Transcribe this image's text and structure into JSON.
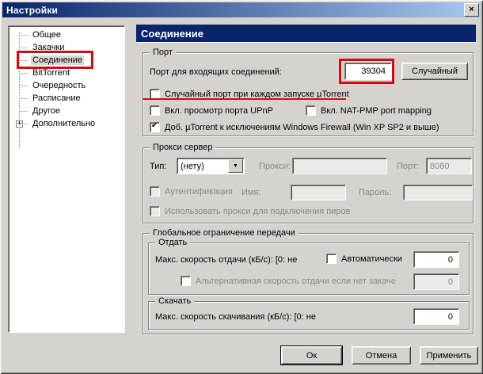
{
  "colors": {
    "titlebar_gradient_start": "#0a246a",
    "titlebar_gradient_end": "#a6caf0",
    "panel_header_bg": "#0a246a",
    "dialog_bg": "#d6d3ce",
    "annotation_red": "#cf0f0f"
  },
  "window": {
    "title": "Настройки",
    "close_glyph": "×"
  },
  "sidebar": {
    "items": [
      {
        "label": "Общее",
        "selected": false
      },
      {
        "label": "Закачки",
        "selected": false
      },
      {
        "label": "Соединение",
        "selected": true
      },
      {
        "label": "BitTorrent",
        "selected": false
      },
      {
        "label": "Очередность",
        "selected": false
      },
      {
        "label": "Расписание",
        "selected": false
      },
      {
        "label": "Другое",
        "selected": false
      },
      {
        "label": "Дополнительно",
        "selected": false,
        "expand_glyph": "+"
      }
    ]
  },
  "header": {
    "title": "Соединение"
  },
  "port": {
    "group_title": "Порт",
    "incoming_label": "Порт для входящих соединений:",
    "port_value": "39304",
    "random_button": "Случайный",
    "cb_random_port": {
      "label": "Случайный порт при каждом запуске µTorrent",
      "checked": false
    },
    "cb_upnp": {
      "label": "Вкл. просмотр порта UPnP",
      "checked": false
    },
    "cb_natpmp": {
      "label": "Вкл. NAT-PMP port mapping",
      "checked": false
    },
    "cb_firewall": {
      "label": "Доб. µTorrent к исключениям Windows Firewall (Win XP SP2 и выше)",
      "checked": true
    }
  },
  "proxy": {
    "group_title": "Прокси сервер",
    "type_label": "Тип:",
    "type_value": "(нету)",
    "proxy_label": "Прокси:",
    "proxy_value": "",
    "port_label": "Порт:",
    "port_value": "8080",
    "cb_auth": {
      "label": "Аутентификация",
      "checked": false
    },
    "name_label": "Имя:",
    "name_value": "",
    "password_label": "Пароль:",
    "password_value": "",
    "cb_peer_proxy": {
      "label": "Использовать прокси для подключения пиров",
      "checked": false
    }
  },
  "limits": {
    "group_title": "Глобальное ограничение передачи",
    "upload": {
      "group_title": "Отдать",
      "max_label": "Макс. скорость отдачи (кБ/с): [0: не",
      "cb_auto": {
        "label": "Автоматически",
        "checked": false
      },
      "value": "0",
      "cb_alt": {
        "label": "Альтернативная скорость отдачи если нет закаче",
        "checked": false
      },
      "alt_value": "0"
    },
    "download": {
      "group_title": "Скачать",
      "max_label": "Макс. скорость скачивания (кБ/с): [0: не",
      "value": "0"
    }
  },
  "buttons": {
    "ok": "Ок",
    "cancel": "Отмена",
    "apply": "Применить"
  }
}
